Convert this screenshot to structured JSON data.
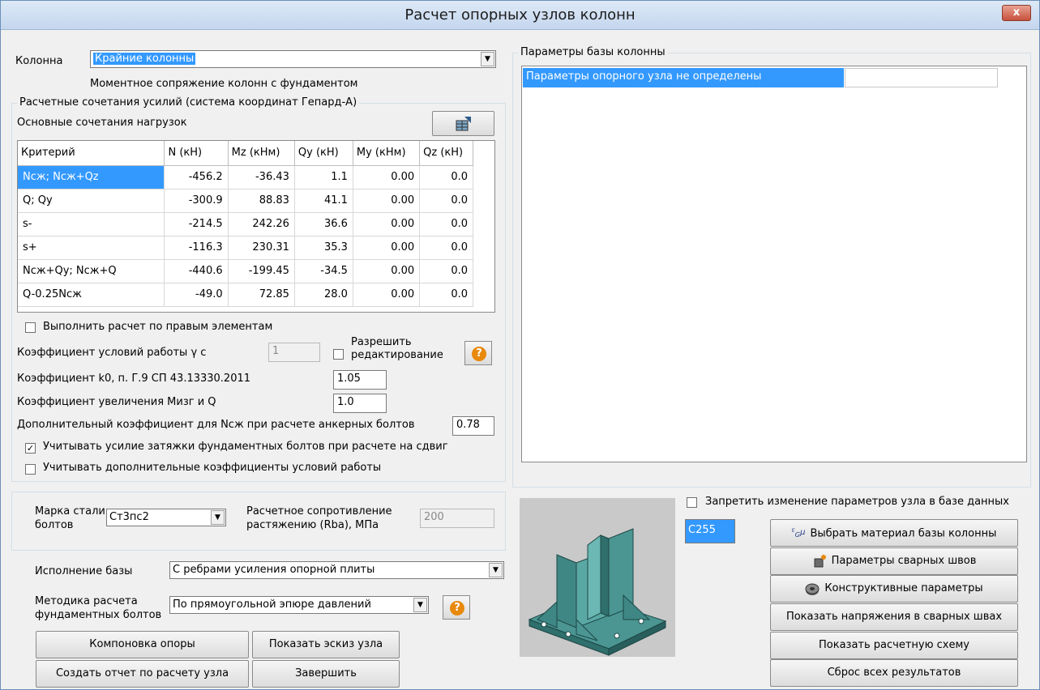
{
  "window": {
    "title": "Расчет опорных узлов колонн",
    "close_label": "x"
  },
  "column": {
    "label": "Колонна",
    "selected": "Крайние колонны",
    "connection_text": "Моментное сопряжение колонн с фундаментом"
  },
  "forces": {
    "group_title": "Расчетные сочетания усилий (система координат Гепард-А)",
    "subtitle": "Основные сочетания нагрузок",
    "headers": [
      "Критерий",
      "N (кН)",
      "Mz (кНм)",
      "Qy (кН)",
      "My (кНм)",
      "Qz (кН)"
    ],
    "rows": [
      [
        "Nсж; Nсж+Qz",
        "-456.2",
        "-36.43",
        "1.1",
        "0.00",
        "0.0"
      ],
      [
        "Q; Qy",
        "-300.9",
        "88.83",
        "41.1",
        "0.00",
        "0.0"
      ],
      [
        "s-",
        "-214.5",
        "242.26",
        "36.6",
        "0.00",
        "0.0"
      ],
      [
        "s+",
        "-116.3",
        "230.31",
        "35.3",
        "0.00",
        "0.0"
      ],
      [
        "Nсж+Qy; Nсж+Q",
        "-440.6",
        "-199.45",
        "-34.5",
        "0.00",
        "0.0"
      ],
      [
        "Q-0.25Nсж",
        "-49.0",
        "72.85",
        "28.0",
        "0.00",
        "0.0"
      ]
    ]
  },
  "options": {
    "right_elements_label": "Выполнить расчет по правым элементам",
    "gamma_label": "Коэффициент условий работы",
    "gamma_symbol": "γ с",
    "gamma_value": "1",
    "allow_edit_label_1": "Разрешить",
    "allow_edit_label_2": "редактирование",
    "k0_label": "Коэффициент k0, п. Г.9 СП 43.13330.2011",
    "k0_value": "1.05",
    "increase_label": "Коэффициент увеличения  Мизг и Q",
    "increase_value": "1.0",
    "extra_coef_label": "Дополнительный коэффициент для Nсж при расчете анкерных болтов",
    "extra_coef_value": "0.78",
    "tension_label": "Учитывать усилие затяжки фундаментных болтов при расчете на сдвиг",
    "tension_checked": true,
    "extra_work_label": "Учитывать дополнительные коэффициенты условий работы",
    "extra_work_checked": false
  },
  "bolts": {
    "steel_label_1": "Марка стали",
    "steel_label_2": "болтов",
    "steel_value": "Ст3пс2",
    "resistance_label_1": "Расчетное сопротивление",
    "resistance_label_2": "растяжению (Rba), МПа",
    "resistance_value": "200"
  },
  "base": {
    "execution_label": "Исполнение базы",
    "execution_value": "С ребрами усиления опорной плиты",
    "method_label_1": "Методика расчета",
    "method_label_2": "фундаментных болтов",
    "method_value": "По прямоугольной эпюре давлений"
  },
  "buttons": {
    "layout": "Компоновка опоры",
    "sketch": "Показать эскиз узла",
    "report": "Создать отчет по расчету узла",
    "finish": "Завершить",
    "material": "Выбрать материал базы колонны",
    "welds": "Параметры сварных швов",
    "constructive": "Конструктивные параметры",
    "weld_stress": "Показать напряжения в сварных швах",
    "scheme": "Показать расчетную схему",
    "reset": "Сброс всех результатов"
  },
  "params": {
    "group_title": "Параметры базы колонны",
    "row_text": "Параметры опорного узла не определены",
    "forbid_label": "Запретить изменение параметров узла в базе данных",
    "material_value": "С255"
  },
  "colors": {
    "accent": "#3399ff",
    "steel_model": "#3a7d7a",
    "help_orange": "#e8890c"
  },
  "icons": [
    "close-icon",
    "table-export-icon",
    "help-icon",
    "material-icon",
    "weld-icon",
    "gear-icon",
    "dropdown-arrow-icon"
  ]
}
